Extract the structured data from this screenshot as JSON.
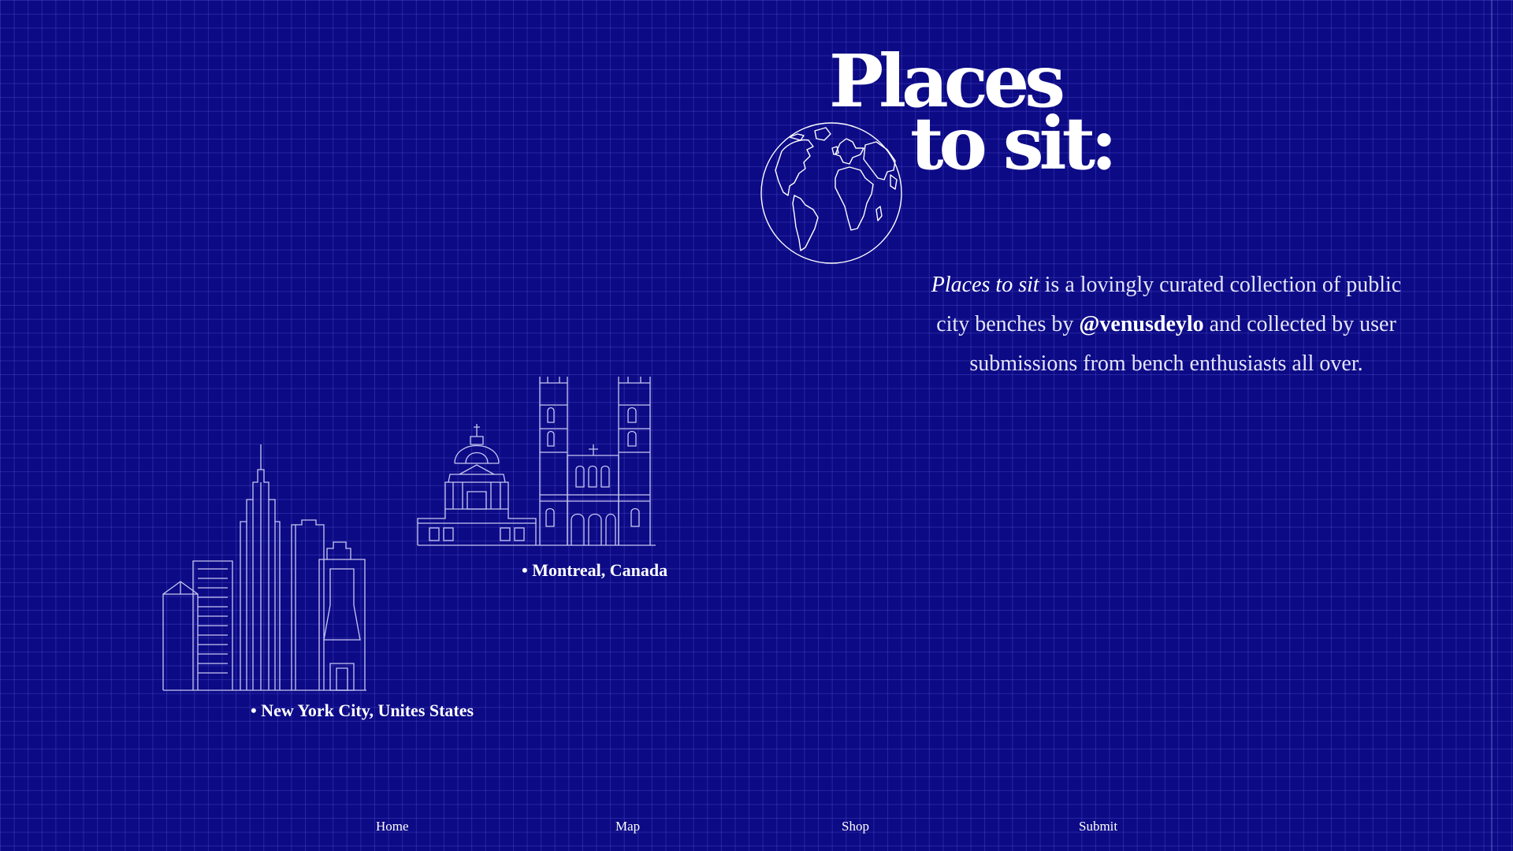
{
  "hero": {
    "title_line_1": "Places",
    "title_line_2": "to sit:"
  },
  "intro": {
    "title_italic": "Places to sit",
    "text_1": " is a lovingly curated collection of public city benches by ",
    "handle": "@venusdeylo",
    "text_2": " and collected by user submissions from bench enthusiasts all over."
  },
  "cities": [
    {
      "label": "• Montreal, Canada",
      "icon": "montreal-skyline-icon"
    },
    {
      "label": "• New York City, Unites States",
      "icon": "new-york-skyline-icon"
    }
  ],
  "nav": {
    "items": [
      {
        "label": "Home"
      },
      {
        "label": "Map"
      },
      {
        "label": "Shop"
      },
      {
        "label": "Submit"
      }
    ]
  },
  "colors": {
    "background": "#0c0a85",
    "grid": "#6e6eeb",
    "text": "#ffffff"
  }
}
